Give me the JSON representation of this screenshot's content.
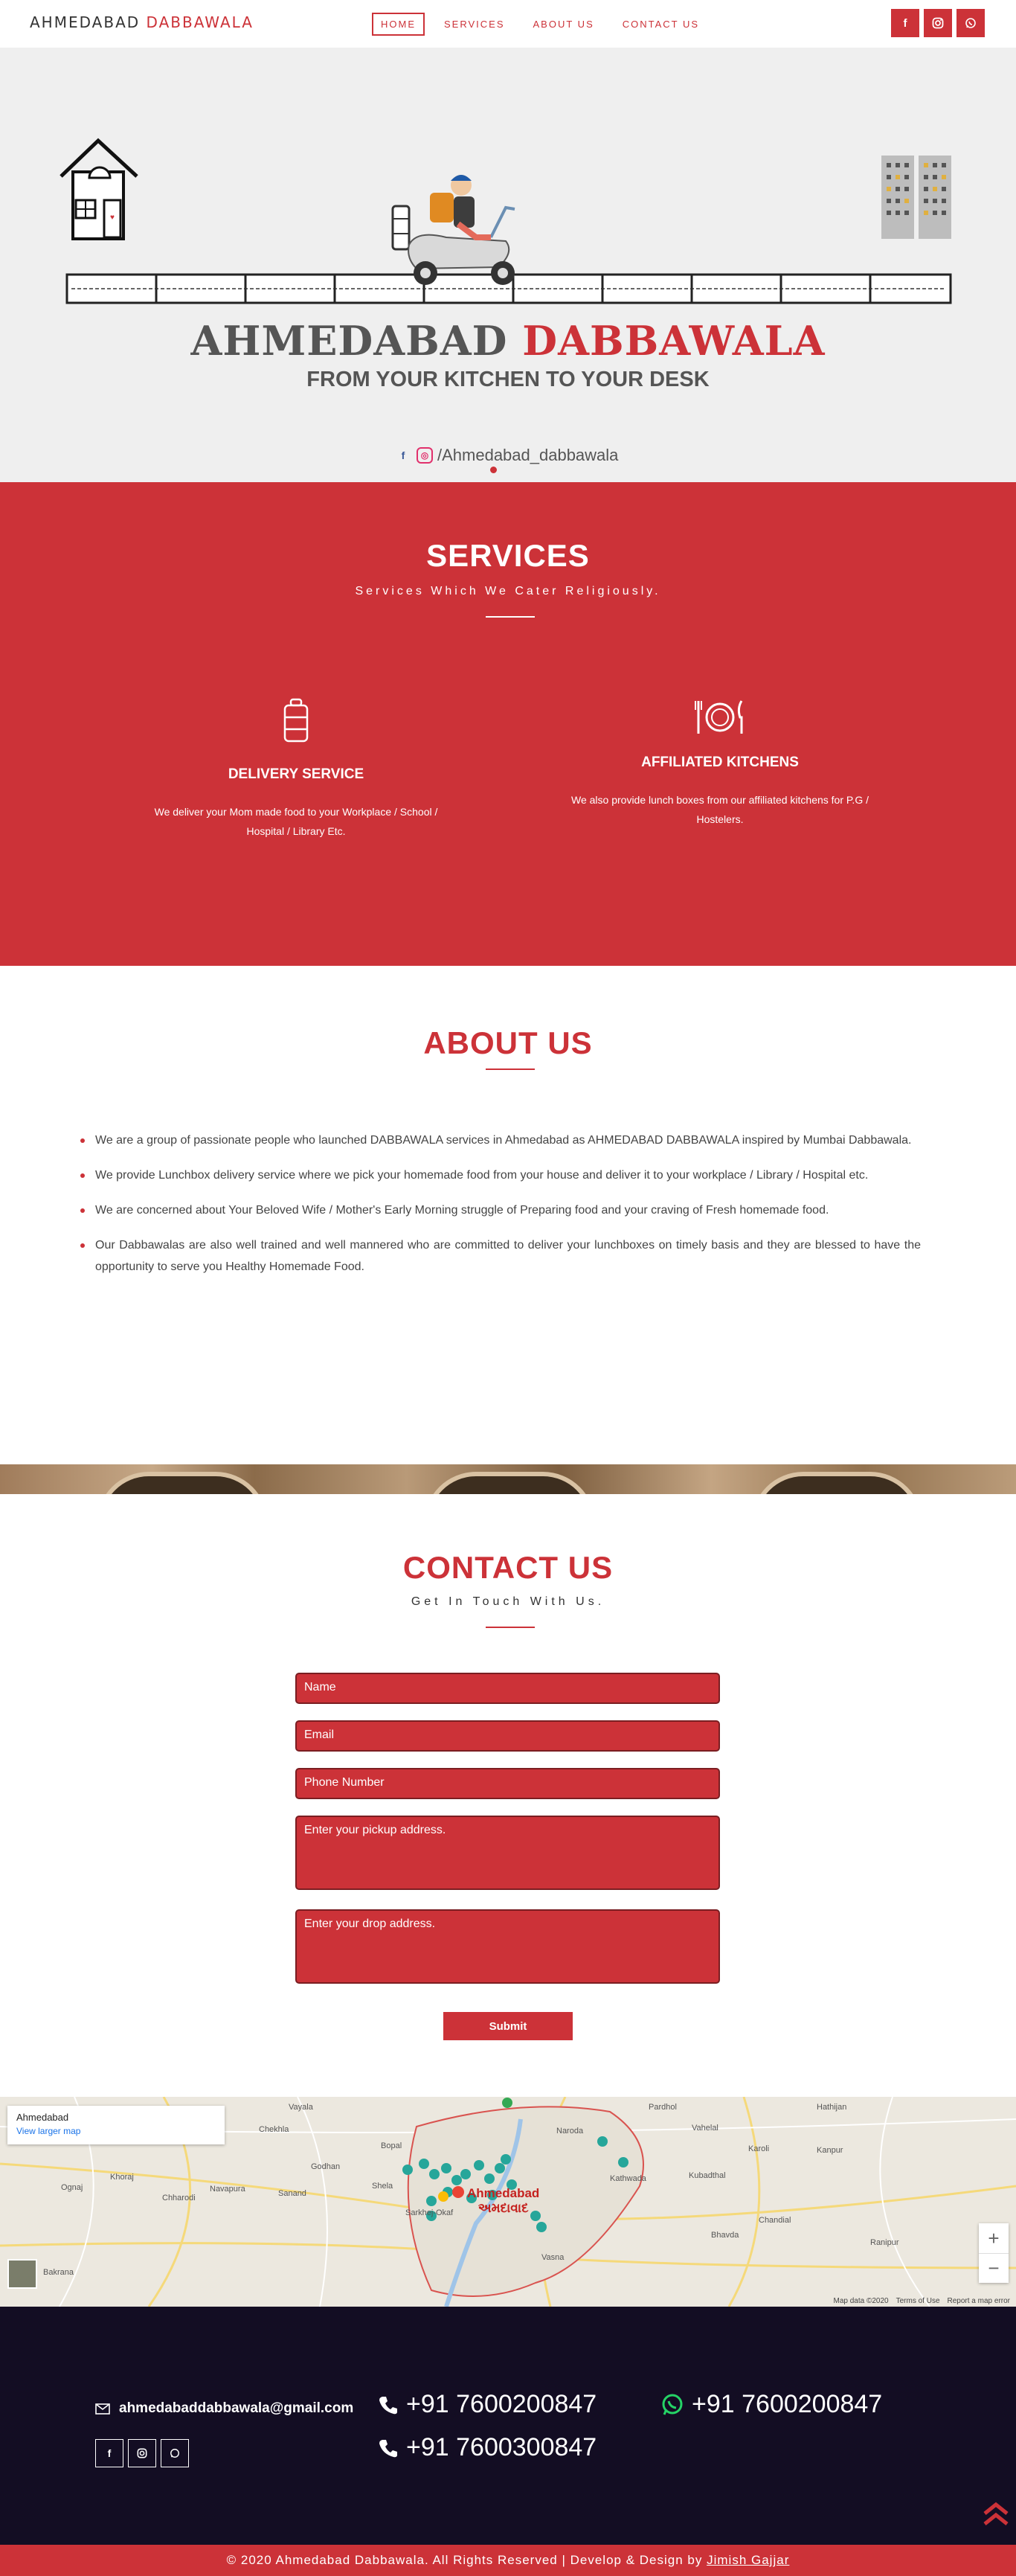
{
  "brand": {
    "part1": "AHMEDABAD",
    "part2": "DABBAWALA"
  },
  "nav": [
    {
      "label": "HOME",
      "active": true
    },
    {
      "label": "SERVICES",
      "active": false
    },
    {
      "label": "ABOUT US",
      "active": false
    },
    {
      "label": "CONTACT US",
      "active": false
    }
  ],
  "social_icons": [
    "facebook-icon",
    "instagram-icon",
    "whatsapp-icon"
  ],
  "hero": {
    "title_part1": "AHMEDABAD",
    "title_part2": "DABBAWALA",
    "subtitle": "FROM YOUR KITCHEN TO YOUR DESK",
    "social_handle": "/Ahmedabad_dabbawala"
  },
  "services": {
    "title": "SERVICES",
    "subtitle": "Services Which We Cater Religiously.",
    "items": [
      {
        "icon": "tiffin-box-icon",
        "title": "DELIVERY SERVICE",
        "text": "We deliver your Mom made food to your Workplace / School / Hospital / Library Etc."
      },
      {
        "icon": "plate-fork-knife-icon",
        "title": "AFFILIATED KITCHENS",
        "text": "We also provide lunch boxes from our affiliated kitchens for P.G / Hostelers."
      }
    ]
  },
  "about": {
    "title": "ABOUT US",
    "points": [
      "We are a group of passionate people who launched DABBAWALA services in Ahmedabad as AHMEDABAD DABBAWALA inspired by Mumbai Dabbawala.",
      "We provide Lunchbox delivery service where we pick your homemade food from your house and deliver it to your workplace / Library / Hospital etc.",
      "We are concerned about Your Beloved Wife / Mother's Early Morning struggle of Preparing food and your craving of Fresh homemade food.",
      "Our Dabbawalas are also well trained and well mannered who are committed to deliver your lunchboxes on timely basis and they are blessed to have the opportunity to serve you Healthy Homemade Food."
    ]
  },
  "contact": {
    "title": "CONTACT US",
    "subtitle": "Get In Touch With Us.",
    "fields": {
      "name": "Name",
      "email": "Email",
      "phone": "Phone Number",
      "pickup": "Enter your pickup address.",
      "drop": "Enter your drop address."
    },
    "submit_label": "Submit"
  },
  "map": {
    "place_name": "Ahmedabad",
    "larger_map_link": "View larger map",
    "city_label": "Ahmedabad",
    "city_label_local": "અમદાવાદ",
    "footer": [
      "Map data ©2020",
      "Terms of Use",
      "Report a map error"
    ],
    "places": [
      "Sanand",
      "Chekhla",
      "Bopal",
      "Godhan",
      "Shela",
      "Sarkhej-Okaf",
      "Vasna",
      "Naroda",
      "Pardhol",
      "Kathwada",
      "Kubadthal",
      "Bhavda",
      "Kanpur",
      "Hathijan",
      "Ranipur",
      "Bakrana",
      "Ognaj",
      "Khoraj",
      "Chharodi",
      "Navapura",
      "Vayala",
      "Vahelal",
      "Karoli",
      "Chandial"
    ]
  },
  "footer": {
    "email": "ahmedabaddabbawala@gmail.com",
    "phone1": "+91 7600200847",
    "whatsapp": "+91 7600200847",
    "phone2": "+91 7600300847",
    "copyright": "© 2020 Ahmedabad Dabbawala. All Rights Reserved | Develop & Design by",
    "author": "Jimish Gajjar"
  },
  "colors": {
    "accent": "#cc3238",
    "footer_bg": "#130d23",
    "hero_bg": "#efefef",
    "text": "#333333"
  }
}
